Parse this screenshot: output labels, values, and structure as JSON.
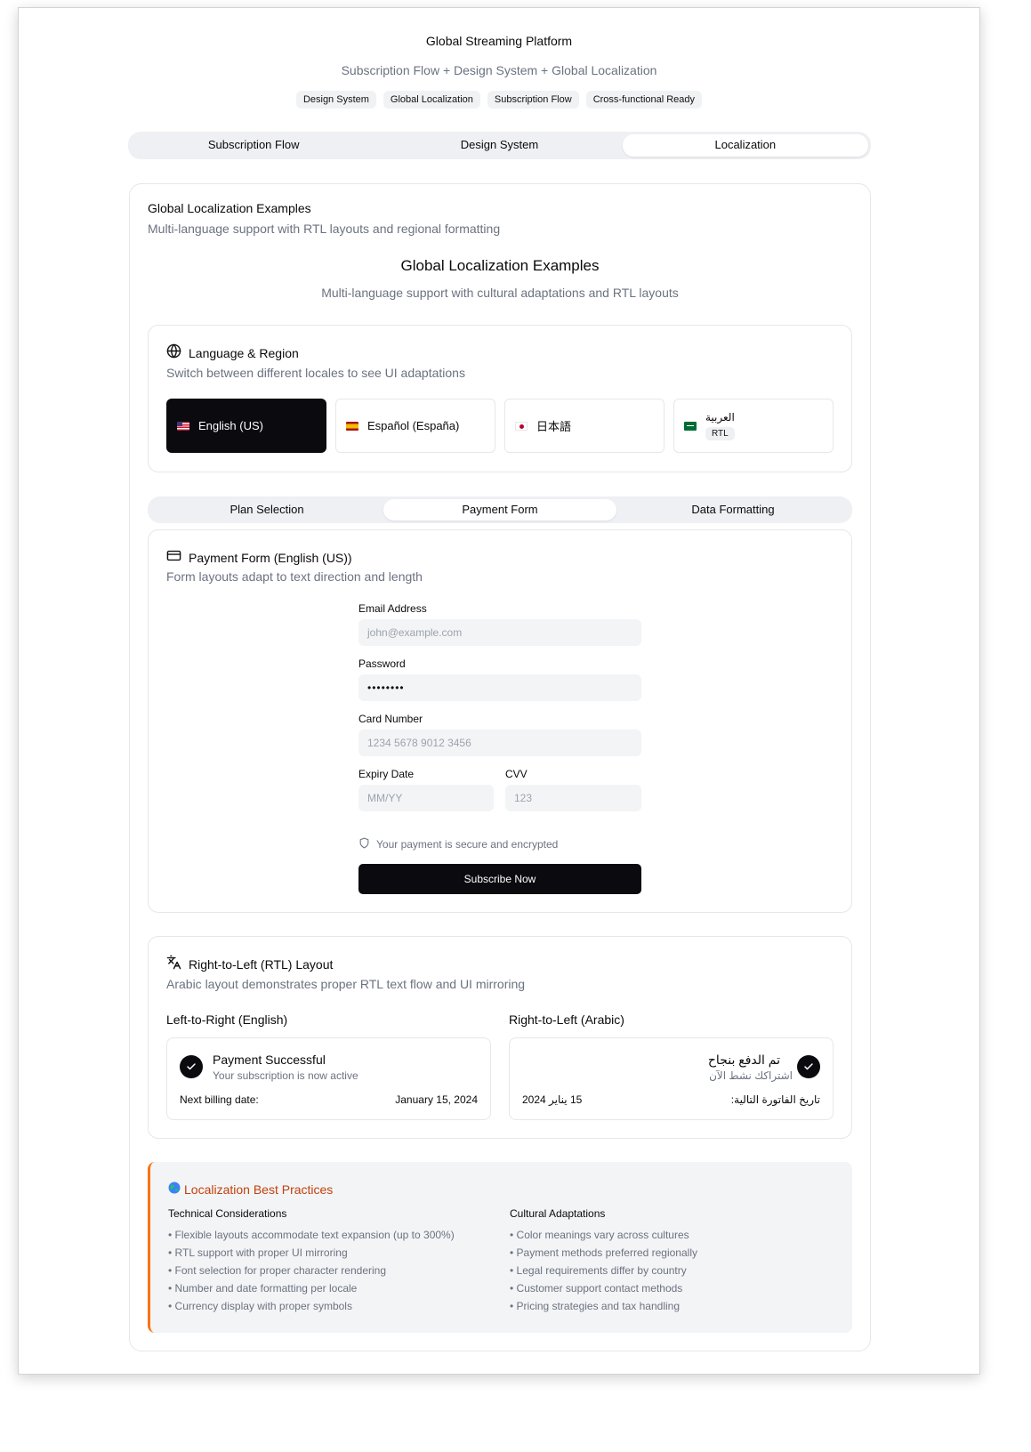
{
  "app": {
    "title": "Global Streaming Platform",
    "subtitle": "Subscription Flow + Design System + Global Localization",
    "tags": [
      "Design System",
      "Global Localization",
      "Subscription Flow",
      "Cross-functional Ready"
    ]
  },
  "main_tabs": [
    {
      "label": "Subscription Flow",
      "active": false
    },
    {
      "label": "Design System",
      "active": false
    },
    {
      "label": "Localization",
      "active": true
    }
  ],
  "localization": {
    "card_title": "Global Localization Examples",
    "card_description": "Multi-language support with RTL layouts and regional formatting",
    "heading": "Global Localization Examples",
    "heading_sub": "Multi-language support with cultural adaptations and RTL layouts"
  },
  "language_region": {
    "icon": "globe-icon",
    "title": "Language & Region",
    "description": "Switch between different locales to see UI adaptations",
    "locales": [
      {
        "label": "English (US)",
        "flag": "us-flag-icon",
        "active": true
      },
      {
        "label": "Español (España)",
        "flag": "spain-flag-icon",
        "active": false
      },
      {
        "label": "日本語",
        "flag": "japan-flag-icon",
        "active": false
      },
      {
        "label": "العربية",
        "flag": "saudi-flag-icon",
        "badge": "RTL",
        "active": false
      }
    ]
  },
  "sub_tabs": [
    {
      "label": "Plan Selection",
      "active": false
    },
    {
      "label": "Payment Form",
      "active": true
    },
    {
      "label": "Data Formatting",
      "active": false
    }
  ],
  "payment_form": {
    "icon": "credit-card-icon",
    "title": "Payment Form (English (US))",
    "description": "Form layouts adapt to text direction and length",
    "email": {
      "label": "Email Address",
      "placeholder": "john@example.com"
    },
    "password": {
      "label": "Password",
      "value": "••••••••"
    },
    "card": {
      "label": "Card Number",
      "placeholder": "1234 5678 9012 3456"
    },
    "expiry": {
      "label": "Expiry Date",
      "placeholder": "MM/YY"
    },
    "cvv": {
      "label": "CVV",
      "placeholder": "123"
    },
    "secure_note": "Your payment is secure and encrypted",
    "submit_label": "Subscribe Now"
  },
  "rtl_layout": {
    "icon": "translate-icon",
    "title": "Right-to-Left (RTL) Layout",
    "description": "Arabic layout demonstrates proper RTL text flow and UI mirroring",
    "ltr": {
      "heading": "Left-to-Right (English)",
      "status_title": "Payment Successful",
      "status_sub": "Your subscription is now active",
      "billing_label": "Next billing date:",
      "billing_value": "January 15, 2024"
    },
    "rtl": {
      "heading": "Right-to-Left (Arabic)",
      "status_title": "تم الدفع بنجاح",
      "status_sub": "اشتراكك نشط الآن",
      "billing_label": "تاريخ الفاتورة التالية:",
      "billing_value": "15 يناير 2024"
    }
  },
  "best_practices": {
    "icon": "earth-emoji-icon",
    "title": "Localization Best Practices",
    "accent": "#c2410c",
    "technical": {
      "title": "Technical Considerations",
      "items": [
        "Flexible layouts accommodate text expansion (up to 300%)",
        "RTL support with proper UI mirroring",
        "Font selection for proper character rendering",
        "Number and date formatting per locale",
        "Currency display with proper symbols"
      ]
    },
    "cultural": {
      "title": "Cultural Adaptations",
      "items": [
        "Color meanings vary across cultures",
        "Payment methods preferred regionally",
        "Legal requirements differ by country",
        "Customer support contact methods",
        "Pricing strategies and tax handling"
      ]
    }
  }
}
